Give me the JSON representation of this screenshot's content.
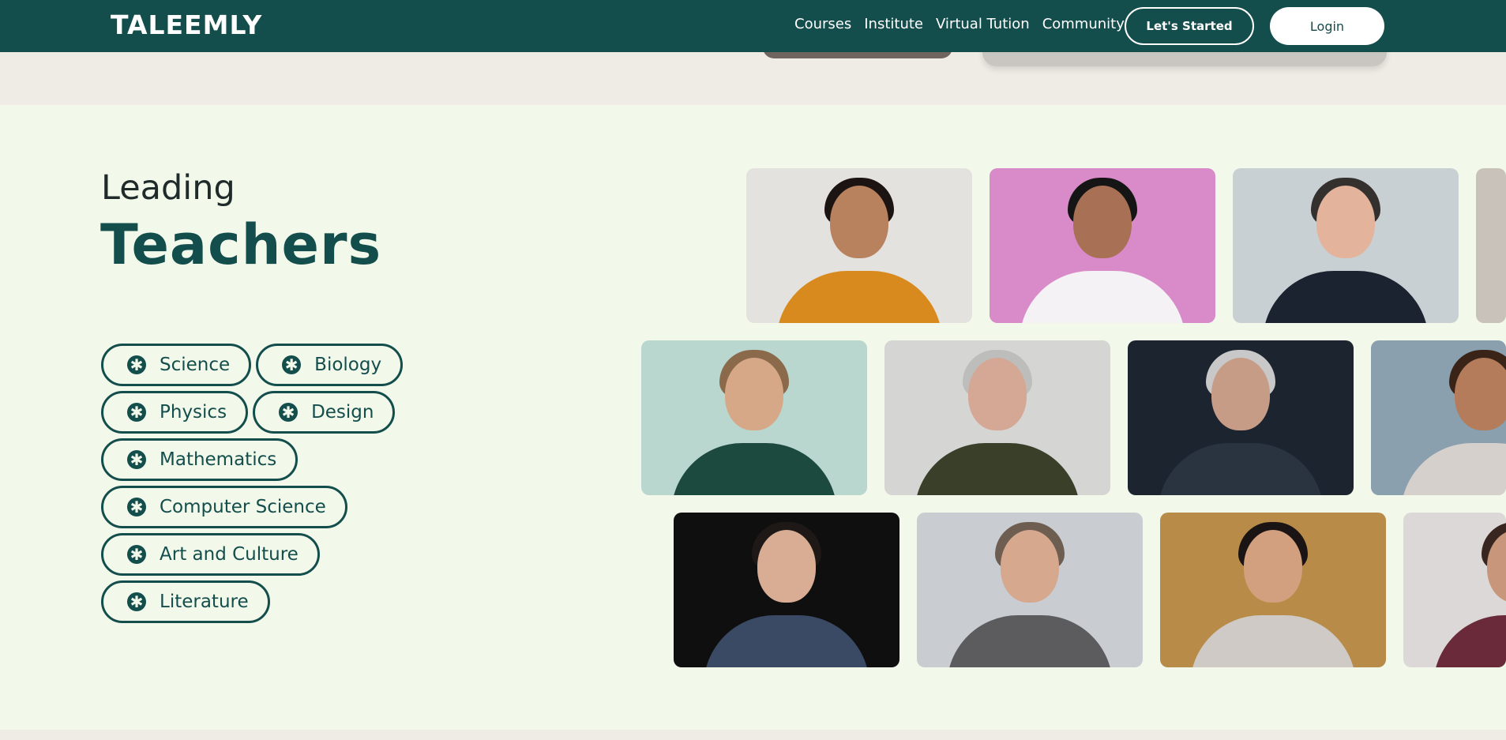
{
  "navbar": {
    "logo": "TALEEMLY",
    "links": [
      "Courses",
      "Institute",
      "Virtual Tution",
      "Community"
    ],
    "start_button": "Let's Started",
    "login_button": "Login"
  },
  "section": {
    "heading_small": "Leading",
    "heading_large": "Teachers"
  },
  "subjects": [
    [
      "Science",
      "Biology"
    ],
    [
      "Physics",
      "Design"
    ],
    [
      "Mathematics"
    ],
    [
      "Computer Science"
    ],
    [
      "Art and Culture"
    ],
    [
      "Literature"
    ]
  ],
  "subject_icon": "asterisk-icon",
  "colors": {
    "brand": "#134d4c",
    "section_bg": "#f2f9ea",
    "page_bg": "#efece6"
  },
  "teacher_photos": [
    {
      "name": "teacher-photo-woman-orange-sweater",
      "bg": "#e4e2df",
      "skin": "#b9825f",
      "hair": "#1b1412",
      "cloth": "#d88a1e"
    },
    {
      "name": "teacher-photo-woman-hijab",
      "bg": "#d98ac8",
      "skin": "#a87055",
      "hair": "#151515",
      "cloth": "#f4f2f4"
    },
    {
      "name": "teacher-photo-man-glasses-suit",
      "bg": "#c8d0d4",
      "skin": "#e4b39c",
      "hair": "#33302d",
      "cloth": "#1b2230"
    },
    {
      "name": "teacher-photo-partial-row1",
      "bg": "#c8c2ba",
      "skin": "#d8b49a",
      "hair": "#8a7a6a",
      "cloth": "#7a746e"
    },
    {
      "name": "teacher-photo-man-beard-glasses",
      "bg": "#b9d6cf",
      "skin": "#d6a888",
      "hair": "#8a6a4a",
      "cloth": "#1d4a3e"
    },
    {
      "name": "teacher-photo-older-man-glasses",
      "bg": "#d5d5d3",
      "skin": "#d4a894",
      "hair": "#bdbdbb",
      "cloth": "#3a3f2a"
    },
    {
      "name": "teacher-photo-older-woman-jacket",
      "bg": "#1c2430",
      "skin": "#c69c86",
      "hair": "#c8c8c8",
      "cloth": "#2a3440"
    },
    {
      "name": "teacher-photo-woman-smiling",
      "bg": "#8aa0ae",
      "skin": "#b57c5c",
      "hair": "#3a2418",
      "cloth": "#d5d0cc"
    },
    {
      "name": "teacher-photo-young-man-smiling",
      "bg": "#0f0f10",
      "skin": "#d8ad94",
      "hair": "#1e1816",
      "cloth": "#3a4a64"
    },
    {
      "name": "teacher-photo-woman-gray-blazer",
      "bg": "#c9cdd2",
      "skin": "#d6a88e",
      "hair": "#6e5e52",
      "cloth": "#5c5c5e"
    },
    {
      "name": "teacher-photo-woman-autumn-hijab",
      "bg": "#b88c48",
      "skin": "#d2a07e",
      "hair": "#1a1414",
      "cloth": "#cfcac6"
    },
    {
      "name": "teacher-photo-partial-row3",
      "bg": "#dcd8d8",
      "skin": "#c8967a",
      "hair": "#3a2620",
      "cloth": "#6a2a3a"
    }
  ]
}
